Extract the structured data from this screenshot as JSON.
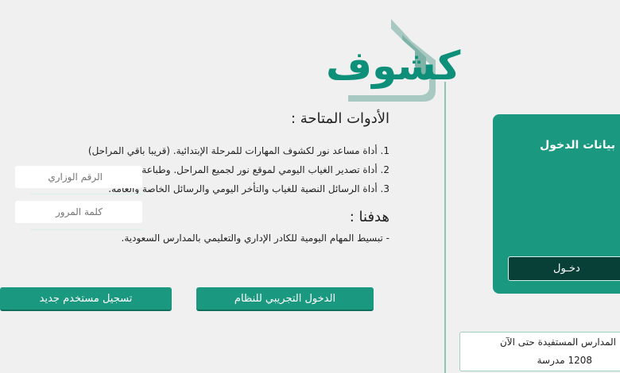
{
  "logo": {
    "text": "كشوف"
  },
  "tools": {
    "title": "الأدوات المتاحة :",
    "items": [
      "1. أداة مساعد نور لكشوف المهارات للمرحلة الإبتدائية. (قريبا باقي المراحل)",
      "2. أداة تصدير الغياب اليومي لموقع نور لجميع المراحل. وطباعة التقارير الإحصائية.",
      "3. أداة الرسائل النصية للغياب والتأخر اليومي والرسائل الخاصة والعامة."
    ]
  },
  "goal": {
    "title": "هدفنا :",
    "text": "- تبسيط المهام اليومية للكادر الإداري والتعليمي بالمدارس السعودية."
  },
  "buttons": {
    "demo_login": "الدخول التجريبي للنظام",
    "register": "تسجيل مستخدم جديد"
  },
  "login": {
    "title": "بيانات الدخول",
    "id_placeholder": "الرقم الوزاري",
    "password_placeholder": "كلمة المرور",
    "submit": "دخـول"
  },
  "stats": {
    "label": "المدارس المستفيدة حتى الآن",
    "count": "1208 مدرسة"
  },
  "colors": {
    "brand": "#1a9980",
    "brand_dark": "#083f36",
    "background": "#f0f0f0"
  }
}
